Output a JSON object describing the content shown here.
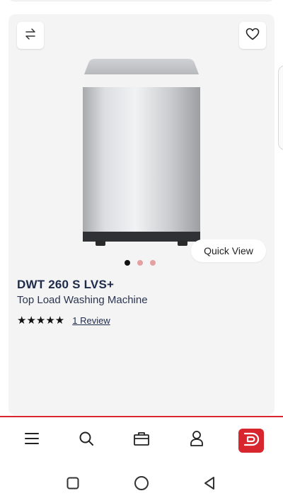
{
  "product": {
    "name": "DWT 260 S LVS+",
    "subtitle": "Top Load Washing Machine",
    "rating_stars": "★★★★★",
    "rating_value": 5,
    "review_link": "1 Review",
    "quick_view_label": "Quick View",
    "image_dots": {
      "count": 3,
      "active_index": 0
    }
  },
  "icons": {
    "compare": "compare-arrows-icon",
    "wishlist": "heart-icon"
  },
  "bottom_nav": {
    "items": [
      {
        "icon": "menu-icon"
      },
      {
        "icon": "search-icon"
      },
      {
        "icon": "bag-icon"
      },
      {
        "icon": "account-icon"
      },
      {
        "icon": "brand-logo-icon"
      }
    ]
  },
  "system_nav": {
    "items": [
      {
        "icon": "recent-apps-icon"
      },
      {
        "icon": "home-icon"
      },
      {
        "icon": "back-icon"
      }
    ]
  },
  "colors": {
    "accent": "#d7262e",
    "card_bg": "#f4f4f4",
    "title": "#1e2a4a",
    "dot_inactive": "#e4a1a1"
  }
}
